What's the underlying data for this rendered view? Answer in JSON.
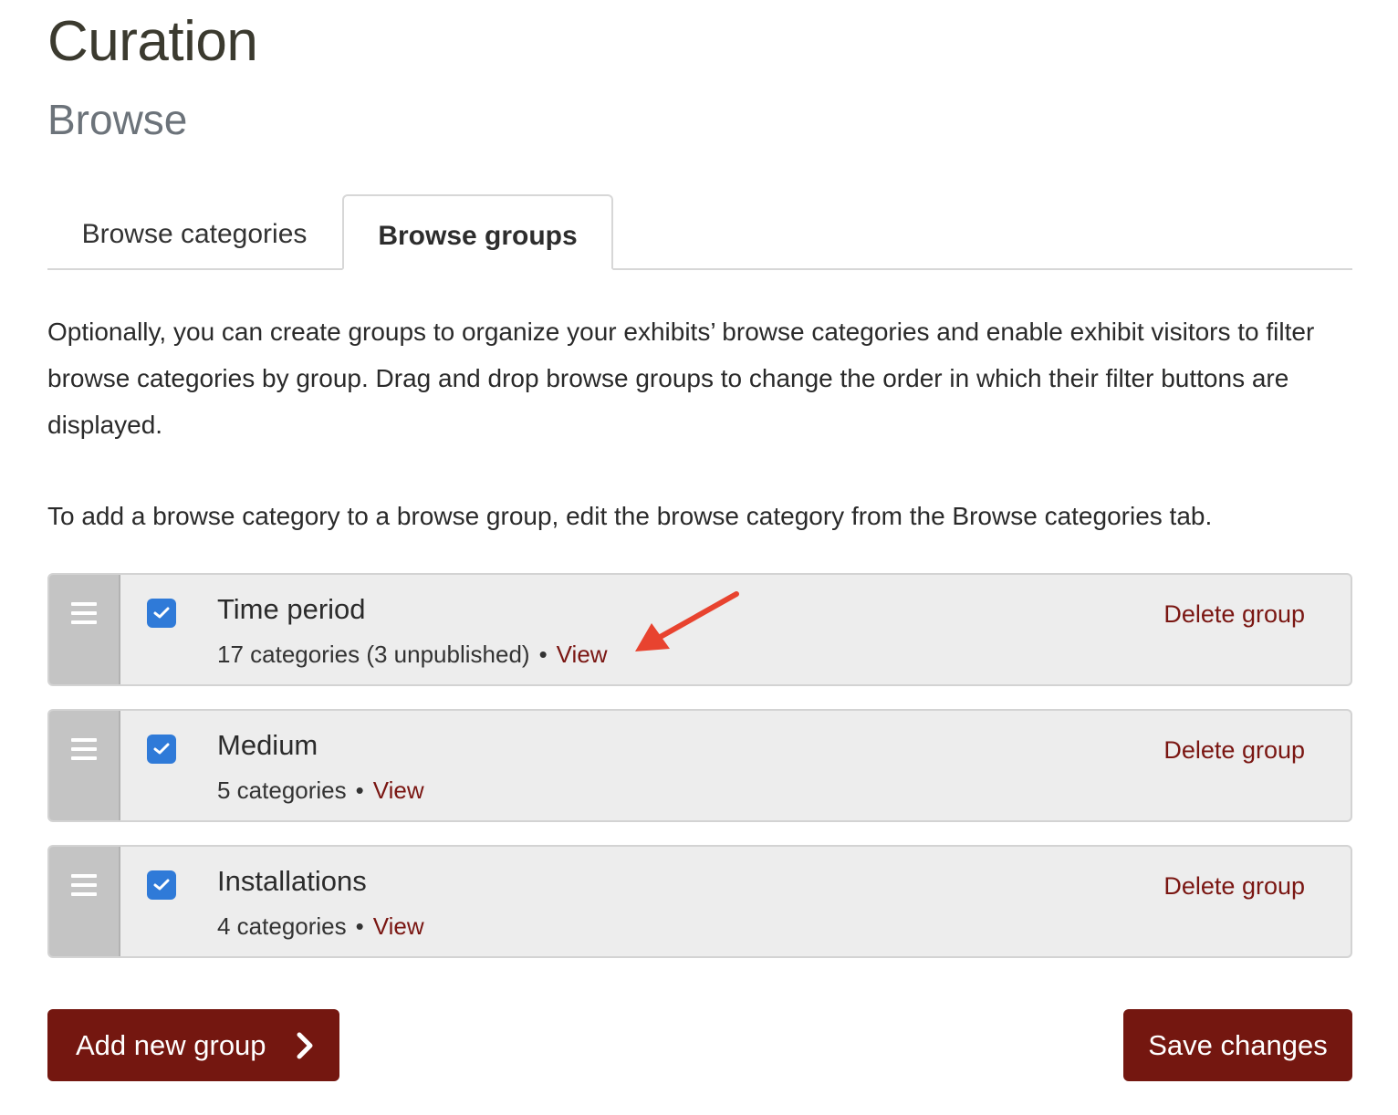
{
  "page": {
    "title": "Curation",
    "subtitle": "Browse"
  },
  "tabs": [
    {
      "label": "Browse categories",
      "active": false
    },
    {
      "label": "Browse groups",
      "active": true
    }
  ],
  "intro": "Optionally, you can create groups to organize your exhibits’ browse categories and enable exhibit visitors to filter browse categories by group. Drag and drop browse groups to change the order in which their filter buttons are displayed.",
  "note": "To add a browse category to a browse group, edit the browse category from the Browse categories tab.",
  "groups": [
    {
      "name": "Time period",
      "meta": "17 categories  (3 unpublished)",
      "view_label": "View",
      "delete_label": "Delete group",
      "checked": true
    },
    {
      "name": "Medium",
      "meta": "5 categories",
      "view_label": "View",
      "delete_label": "Delete group",
      "checked": true
    },
    {
      "name": "Installations",
      "meta": "4 categories",
      "view_label": "View",
      "delete_label": "Delete group",
      "checked": true
    }
  ],
  "buttons": {
    "add_label": "Add new group",
    "save_label": "Save changes"
  },
  "colors": {
    "brand": "#741710",
    "link": "#7a1612",
    "checkbox": "#2f7ad8",
    "annotation_arrow": "#e8432f"
  },
  "icons": {
    "drag": "drag-handle-icon",
    "check": "checkmark-icon",
    "chevron": "chevron-right-icon",
    "annotation": "annotation-arrow-icon"
  }
}
